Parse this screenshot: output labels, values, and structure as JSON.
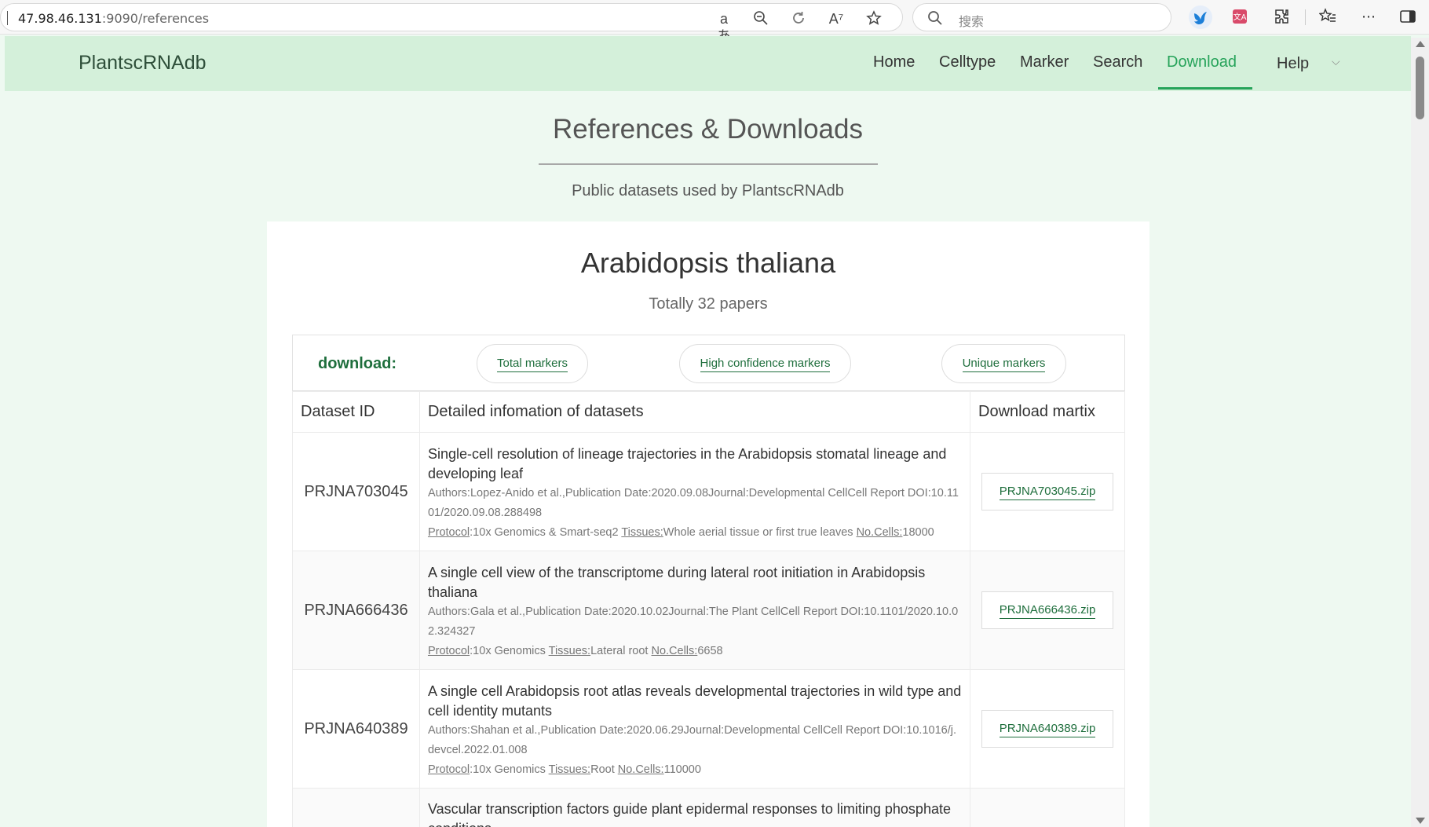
{
  "browser": {
    "url_host": "47.98.46.131",
    "url_path": ":9090/references",
    "search_placeholder": "搜索"
  },
  "nav": {
    "brand": "PlantscRNAdb",
    "items": [
      {
        "label": "Home"
      },
      {
        "label": "Celltype"
      },
      {
        "label": "Marker"
      },
      {
        "label": "Search"
      },
      {
        "label": "Download",
        "active": true
      },
      {
        "label": "Help"
      }
    ]
  },
  "header": {
    "title": "References & Downloads",
    "subtitle": "Public datasets used by PlantscRNAdb"
  },
  "section": {
    "species": "Arabidopsis thaliana",
    "paper_count": "Totally 32 papers",
    "download_label": "download:",
    "download_buttons": [
      "Total markers",
      "High confidence markers",
      "Unique markers"
    ]
  },
  "table": {
    "headers": [
      "Dataset ID",
      "Detailed infomation of datasets",
      "Download martix"
    ],
    "field_labels": {
      "protocol": "Protocol",
      "tissues": "Tissues:",
      "cells": "No.Cells:"
    },
    "rows": [
      {
        "id": "PRJNA703045",
        "title": "Single-cell resolution of lineage trajectories in the Arabidopsis stomatal lineage and developing leaf",
        "authors": "Authors:Lopez-Anido et al.,Publication Date:2020.09.08Journal:Developmental CellCell Report DOI:10.1101/2020.09.08.288498",
        "protocol": ":10x Genomics & Smart-seq2 ",
        "tissues": "Whole aerial tissue or first true leaves ",
        "cells": "18000",
        "zip": "PRJNA703045.zip"
      },
      {
        "id": "PRJNA666436",
        "title": "A single cell view of the transcriptome during lateral root initiation in Arabidopsis thaliana",
        "authors": "Authors:Gala et al.,Publication Date:2020.10.02Journal:The Plant CellCell Report DOI:10.1101/2020.10.02.324327",
        "protocol": ":10x Genomics ",
        "tissues": "Lateral root ",
        "cells": "6658",
        "zip": "PRJNA666436.zip"
      },
      {
        "id": "PRJNA640389",
        "title": "A single cell Arabidopsis root atlas reveals developmental trajectories in wild type and cell identity mutants",
        "authors": "Authors:Shahan et al.,Publication Date:2020.06.29Journal:Developmental CellCell Report DOI:10.1016/j.devcel.2022.01.008",
        "protocol": ":10x Genomics ",
        "tissues": "Root ",
        "cells": "110000",
        "zip": "PRJNA640389.zip"
      },
      {
        "title": "Vascular transcription factors guide plant epidermal responses to limiting phosphate conditions"
      }
    ]
  }
}
